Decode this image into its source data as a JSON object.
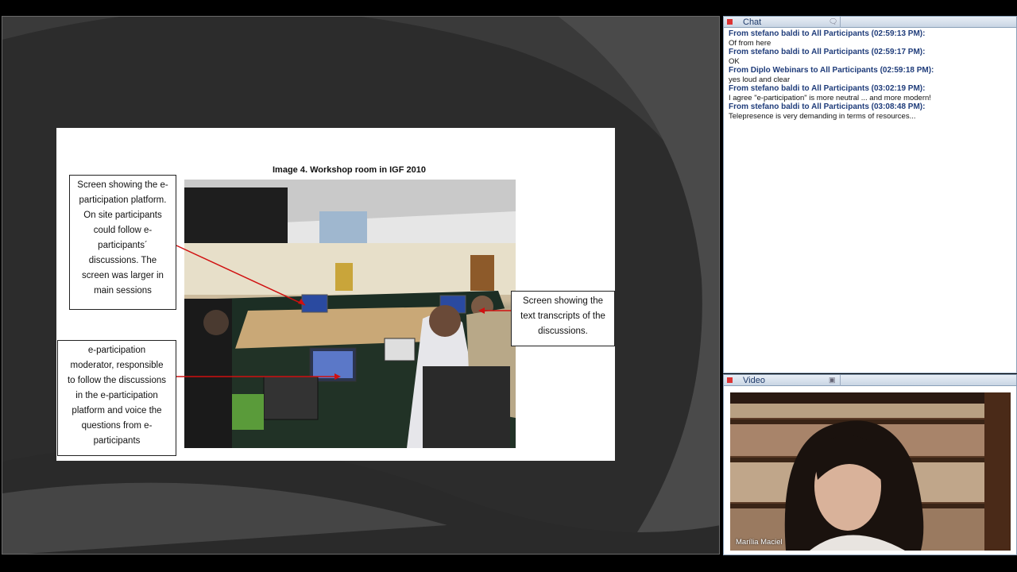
{
  "slide": {
    "title": "Image 4. Workshop room in IGF 2010",
    "callout_screen_platform": [
      "Screen showing the e-",
      "participation platform.",
      "On site participants",
      "could follow e-",
      "participants´",
      "discussions. The",
      "screen was larger in",
      "main sessions"
    ],
    "callout_moderator": [
      "e-participation",
      "moderator, responsible",
      "to follow the discussions",
      "in the e-participation",
      "platform and voice the",
      "questions from e-",
      "participants"
    ],
    "callout_transcripts": [
      "Screen showing the",
      "text transcripts of the",
      "discussions."
    ]
  },
  "chat": {
    "header_title": "Chat",
    "messages": [
      {
        "from": "From stefano baldi to All Participants (02:59:13 PM):",
        "text": "Of from here"
      },
      {
        "from": "From stefano baldi to All Participants (02:59:17 PM):",
        "text": "OK"
      },
      {
        "from": "From Diplo Webinars to All Participants (02:59:18 PM):",
        "text": "yes loud and clear"
      },
      {
        "from": "From stefano baldi to All Participants (03:02:19 PM):",
        "text": "I agree \"e-participation\" is more neutral ... and more modern!"
      },
      {
        "from": "From stefano baldi to All Participants (03:08:48 PM):",
        "text": "Telepresence is very demanding in terms of resources..."
      }
    ]
  },
  "video": {
    "header_title": "Video",
    "participant_name": "Marília Maciel"
  },
  "colors": {
    "stage_bg": "#3a3a3a",
    "panel_border": "#8aa0b8",
    "chat_from": "#1f3c7a",
    "header_text": "#1e3a6a"
  }
}
